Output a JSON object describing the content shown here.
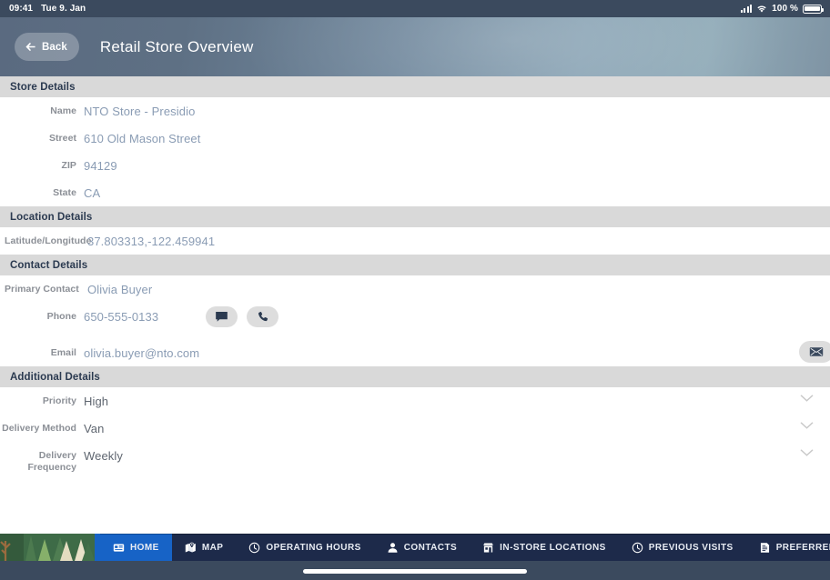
{
  "status_bar": {
    "time": "09:41",
    "date": "Tue 9. Jan",
    "battery_percent": "100 %",
    "signal_icon": "signal-bars-icon",
    "wifi_icon": "wifi-icon",
    "battery_icon": "battery-icon"
  },
  "header": {
    "back_label": "Back",
    "title": "Retail Store Overview"
  },
  "sections": {
    "store_details": {
      "title": "Store Details",
      "fields": [
        {
          "label": "Name",
          "value": "NTO Store - Presidio"
        },
        {
          "label": "Street",
          "value": "610 Old Mason Street"
        },
        {
          "label": "ZIP",
          "value": "94129"
        },
        {
          "label": "State",
          "value": "CA"
        }
      ]
    },
    "location_details": {
      "title": "Location Details",
      "fields": [
        {
          "label": "Latitude/Longitude",
          "value": "37.803313,-122.459941"
        }
      ]
    },
    "contact_details": {
      "title": "Contact Details",
      "fields": [
        {
          "label": "Primary Contact",
          "value": "Olivia Buyer"
        },
        {
          "label": "Phone",
          "value": "650-555-0133"
        },
        {
          "label": "Email",
          "value": "olivia.buyer@nto.com"
        }
      ],
      "actions": {
        "message_icon": "message-bubble-icon",
        "call_icon": "phone-icon",
        "email_icon": "envelope-icon"
      }
    },
    "additional_details": {
      "title": "Additional Details",
      "fields": [
        {
          "label": "Priority",
          "value": "High"
        },
        {
          "label": "Delivery Method",
          "value": "Van"
        },
        {
          "label": "Delivery Frequency",
          "value": "Weekly"
        }
      ],
      "expander_icon": "chevron-down-icon"
    }
  },
  "bottom_nav": {
    "items": [
      {
        "label": "HOME",
        "icon": "home-card-icon",
        "active": true
      },
      {
        "label": "MAP",
        "icon": "map-pin-icon",
        "active": false
      },
      {
        "label": "OPERATING HOURS",
        "icon": "clock-icon",
        "active": false
      },
      {
        "label": "CONTACTS",
        "icon": "person-icon",
        "active": false
      },
      {
        "label": "IN-STORE LOCATIONS",
        "icon": "storefront-icon",
        "active": false
      },
      {
        "label": "PREVIOUS VISITS",
        "icon": "clock-icon",
        "active": false
      },
      {
        "label": "PREFERRED VISIT HOURS",
        "icon": "document-list-icon",
        "active": false
      }
    ]
  },
  "colors": {
    "accent_active": "#1763c6",
    "nav_bg": "#1d2a4a",
    "chrome_bg": "#3b4a5e",
    "section_bg": "#d9d9d9",
    "value_blue": "#8a9cb4",
    "value_dark": "#5f6670",
    "label_gray": "#8b8f96"
  }
}
